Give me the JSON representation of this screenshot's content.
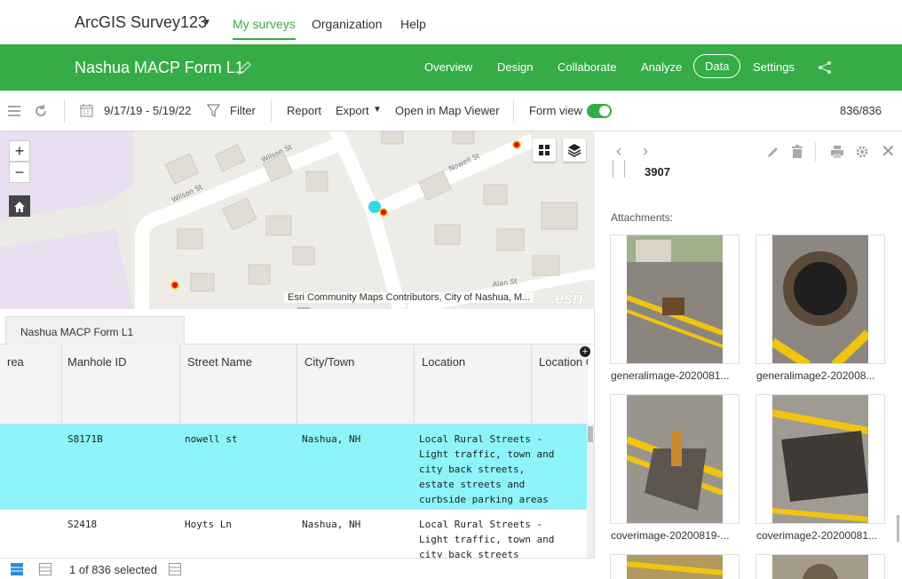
{
  "topnav": {
    "brand": "ArcGIS Survey123",
    "links": [
      "My surveys",
      "Organization",
      "Help"
    ]
  },
  "greenbar": {
    "form_title": "Nashua MACP Form L1",
    "tabs": [
      "Overview",
      "Design",
      "Collaborate",
      "Analyze",
      "Data",
      "Settings"
    ],
    "active_tab": "Data"
  },
  "toolbar": {
    "date_range": "9/17/19 - 5/19/22",
    "filter": "Filter",
    "report": "Report",
    "export": "Export",
    "open_map": "Open in Map Viewer",
    "form_view": "Form view",
    "count": "836/836"
  },
  "map": {
    "streets": [
      "Wilson St",
      "Wilson St",
      "Nowell St",
      "Alan St"
    ],
    "attribution": "Esri Community Maps Contributors, City of Nashua, M...",
    "logo": "esri"
  },
  "table": {
    "tab_name": "Nashua MACP Form L1",
    "columns": [
      "rea",
      "Manhole ID",
      "Street Name",
      "City/Town",
      "Location",
      "Location C"
    ],
    "rows": [
      {
        "id": "S8171B",
        "street": "nowell st",
        "city": "Nashua, NH",
        "location": [
          "Local Rural Streets -",
          "Light traffic, town and",
          "city back streets,",
          "estate streets and",
          "curbside parking areas"
        ],
        "selected": true
      },
      {
        "id": "S2418",
        "street": "Hoyts Ln",
        "city": "Nashua, NH",
        "location": [
          "Local Rural Streets -",
          "Light traffic, town and",
          "city back streets"
        ],
        "selected": false
      }
    ],
    "footer": "1 of 836 selected"
  },
  "panel": {
    "value": "3907",
    "attachments_label": "Attachments:",
    "attachments": [
      {
        "caption": "generalimage-2020081..."
      },
      {
        "caption": "generalimage2-202008..."
      },
      {
        "caption": "coverimage-20200819-..."
      },
      {
        "caption": "coverimage2-20200081..."
      }
    ]
  },
  "colors": {
    "brand_green": "#35ac46",
    "selected_row": "#8cf4fa"
  }
}
